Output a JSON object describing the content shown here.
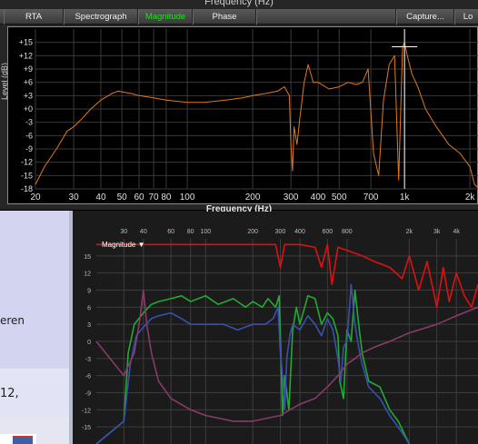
{
  "top_window": {
    "title": "Frequency (Hz)",
    "tabs": [
      {
        "label": "RTA",
        "active": false
      },
      {
        "label": "Spectrograph",
        "active": false
      },
      {
        "label": "Magnitude",
        "active": true
      },
      {
        "label": "Phase",
        "active": false
      },
      {
        "label": "Capture...",
        "active": false
      },
      {
        "label": "Lo",
        "active": false
      }
    ],
    "y_axis_label": "Level (dB)",
    "x_axis_label": "Frequency (Hz)",
    "active_color": "#22dd22",
    "trace_color": "#e07a1f"
  },
  "bottom_window": {
    "title": "Magnitude ▼",
    "trace_colors": {
      "red": "#e01010",
      "green": "#22aa33",
      "blue": "#3a4fb0",
      "purple": "#8a3a6a"
    }
  },
  "background_page": {
    "text_line1": "eren",
    "text_line2": "12,"
  },
  "chart_data": [
    {
      "type": "line",
      "title": "",
      "xlabel": "Frequency (Hz)",
      "ylabel": "Level (dB)",
      "x_scale": "log",
      "xlim": [
        20,
        2200
      ],
      "ylim": [
        -18,
        18
      ],
      "x_ticks": [
        20,
        30,
        40,
        50,
        60,
        70,
        80,
        100,
        200,
        300,
        400,
        500,
        700,
        1000,
        2000
      ],
      "x_tick_labels": [
        "20",
        "30",
        "40",
        "50",
        "60",
        "70",
        "80",
        "100",
        "200",
        "300",
        "400",
        "500",
        "700",
        "1k",
        "2k"
      ],
      "y_ticks": [
        15,
        12,
        9,
        6,
        3,
        0,
        -3,
        -6,
        -9,
        -12,
        -15,
        -18
      ],
      "y_tick_labels": [
        "+15",
        "+12",
        "+9",
        "+6",
        "+3",
        "+0",
        "-3",
        "-6",
        "-9",
        "-12",
        "-15",
        "-18"
      ],
      "series": [
        {
          "color": "#e07a1f",
          "x": [
            20,
            22,
            25,
            28,
            30,
            33,
            36,
            40,
            45,
            48,
            55,
            60,
            70,
            80,
            100,
            120,
            150,
            180,
            200,
            230,
            260,
            280,
            295,
            300,
            305,
            310,
            320,
            330,
            345,
            360,
            380,
            400,
            450,
            500,
            550,
            600,
            640,
            680,
            720,
            760,
            800,
            850,
            900,
            940,
            980,
            1000,
            1030,
            1080,
            1150,
            1250,
            1400,
            1600,
            1800,
            2000,
            2100,
            2200
          ],
          "y": [
            -17,
            -13,
            -9,
            -5,
            -4,
            -2,
            0,
            2,
            3.5,
            4,
            3.5,
            3,
            2.5,
            2,
            1.5,
            1.5,
            2,
            2.5,
            3,
            3.5,
            4,
            5,
            3,
            -8,
            -14,
            -4,
            -8,
            -2,
            6,
            10,
            6,
            6,
            4.5,
            5,
            6,
            5.5,
            6,
            9,
            -10,
            -15,
            2,
            10,
            12,
            -16,
            14,
            15,
            12,
            8,
            5,
            0,
            -4,
            -8,
            -10,
            -13,
            -17,
            -18
          ]
        }
      ],
      "cursor_marker": {
        "x": 1000,
        "y": 14
      }
    },
    {
      "type": "line",
      "title": "Magnitude ▼",
      "x_scale": "log",
      "xlim": [
        20,
        5500
      ],
      "ylim": [
        -18,
        18
      ],
      "x_ticks": [
        30,
        40,
        60,
        80,
        100,
        200,
        300,
        400,
        600,
        800,
        2000,
        3000,
        4000
      ],
      "x_tick_labels": [
        "30",
        "40",
        "60",
        "80",
        "100",
        "200",
        "300",
        "400",
        "600",
        "800",
        "2k",
        "3k",
        "4k"
      ],
      "y_ticks": [
        15,
        12,
        9,
        6,
        3,
        0,
        -3,
        -6,
        -9,
        -12,
        -15
      ],
      "y_tick_labels": [
        "15",
        "12",
        "9",
        "6",
        "3",
        "0",
        "-3",
        "-6",
        "-9",
        "-12",
        "-15"
      ],
      "series": [
        {
          "color": "#e01010",
          "x": [
            20,
            200,
            280,
            300,
            320,
            400,
            500,
            550,
            600,
            640,
            700,
            800,
            1000,
            1200,
            1500,
            1800,
            2000,
            2300,
            2600,
            3000,
            3300,
            3600,
            4000,
            4500,
            5000,
            5500
          ],
          "y": [
            17,
            17,
            17,
            13,
            17,
            17,
            16.5,
            13,
            17,
            10,
            16.5,
            16,
            15,
            14,
            13,
            11,
            15,
            9,
            14,
            6,
            13,
            7,
            12,
            8,
            6,
            10
          ]
        },
        {
          "color": "#22aa33",
          "x": [
            20,
            30,
            32,
            35,
            40,
            45,
            50,
            60,
            70,
            80,
            100,
            120,
            150,
            180,
            200,
            230,
            250,
            280,
            295,
            300,
            310,
            320,
            340,
            360,
            380,
            400,
            450,
            500,
            550,
            600,
            650,
            700,
            720,
            760,
            800,
            850,
            900,
            950,
            1000,
            1100,
            1300,
            1500,
            1700,
            2000
          ],
          "y": [
            -18,
            -14,
            -2,
            3,
            5,
            6.5,
            7,
            7.5,
            8,
            7,
            8,
            6.5,
            7.5,
            6,
            7,
            6,
            7.5,
            6,
            8,
            1,
            -13,
            -6,
            -12,
            2,
            6,
            3,
            8,
            7.5,
            3,
            5,
            4,
            1,
            -7,
            -10,
            2,
            0,
            9,
            3,
            -2,
            -7,
            -8,
            -12,
            -14,
            -18
          ]
        },
        {
          "color": "#3a4fb0",
          "x": [
            20,
            30,
            33,
            36,
            40,
            45,
            50,
            60,
            70,
            80,
            100,
            130,
            160,
            200,
            240,
            270,
            290,
            300,
            310,
            320,
            330,
            345,
            360,
            400,
            450,
            500,
            550,
            600,
            650,
            700,
            730,
            760,
            800,
            850,
            900,
            950,
            1000,
            1100,
            1300,
            1500,
            1800,
            2000
          ],
          "y": [
            -18,
            -14,
            -4,
            1,
            2.5,
            4,
            4.5,
            5,
            4,
            3,
            3,
            3,
            2,
            3,
            3,
            4,
            6,
            -2,
            -6,
            -12,
            -3,
            1,
            3,
            2,
            4.5,
            3,
            1,
            4,
            2,
            -3,
            -7,
            -1,
            0,
            10,
            3,
            -1,
            -4,
            -8,
            -10,
            -13,
            -16,
            -18
          ]
        },
        {
          "color": "#8a3a6a",
          "x": [
            20,
            30,
            35,
            38,
            40,
            42,
            45,
            50,
            60,
            80,
            100,
            150,
            200,
            300,
            400,
            500,
            600,
            700,
            800,
            900,
            1000,
            1200,
            1500,
            2000,
            3000,
            4000,
            5500
          ],
          "y": [
            0,
            -6,
            -2,
            4,
            9,
            3,
            -2,
            -7,
            -10,
            -12,
            -13,
            -14,
            -14,
            -13,
            -11,
            -10,
            -8,
            -6,
            -4,
            -3,
            -2,
            -1,
            0,
            1.5,
            3,
            4.5,
            6
          ]
        }
      ]
    }
  ]
}
